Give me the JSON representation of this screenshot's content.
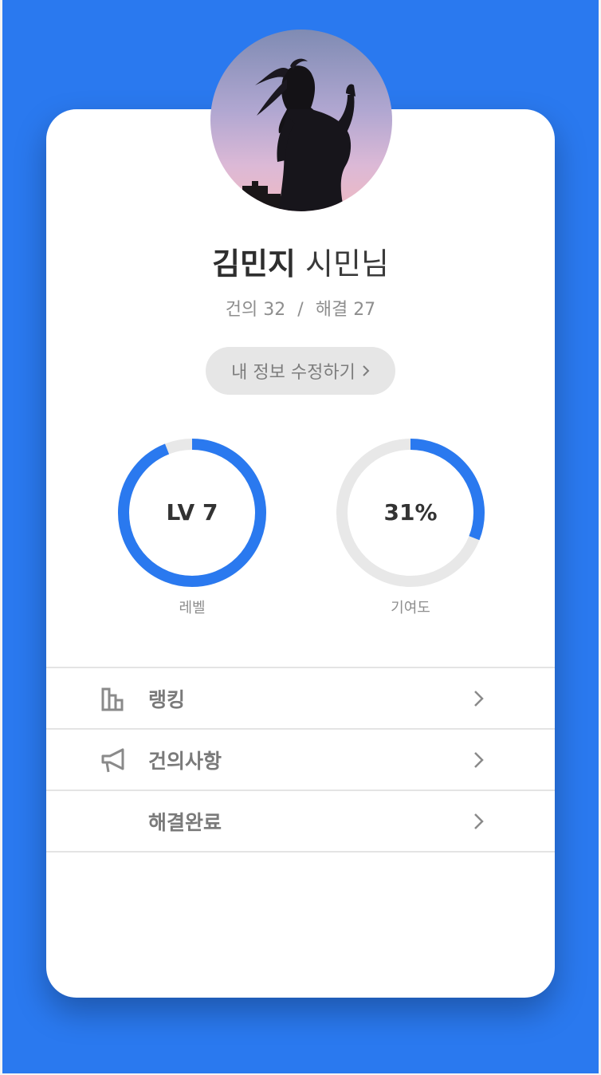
{
  "profile": {
    "name": "김민지",
    "honorific": "시민님",
    "avatar": "profile-photo-silhouette",
    "stats": {
      "proposals_label": "건의",
      "proposals_count": "32",
      "separator": "/",
      "resolved_label": "해결",
      "resolved_count": "27"
    },
    "edit_button_label": "내 정보 수정하기",
    "edit_button_icon": "chevron-right-icon"
  },
  "gauges": [
    {
      "value_text": "LV 7",
      "label": "레벨",
      "progress": 0.94
    },
    {
      "value_text": "31%",
      "label": "기여도",
      "progress": 0.31
    }
  ],
  "menu": {
    "items": [
      {
        "label": "랭킹",
        "icon": "bar-chart-icon"
      },
      {
        "label": "건의사항",
        "icon": "megaphone-icon"
      },
      {
        "label": "해결완료",
        "icon": ""
      }
    ],
    "chevron_icon": "chevron-right-icon"
  },
  "colors": {
    "background": "#2a79ef",
    "accent": "#2a79ef",
    "track": "#e8e8e8",
    "card": "#ffffff"
  }
}
